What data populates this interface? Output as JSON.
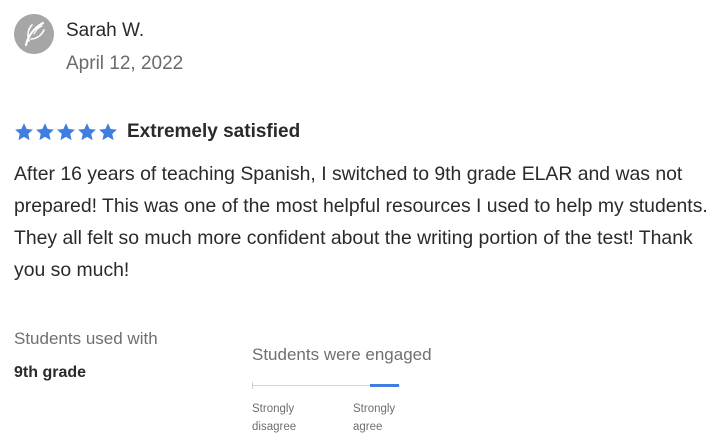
{
  "reviewer": {
    "name": "Sarah W.",
    "date": "April 12, 2022",
    "avatar_icon": "leaf-avatar-icon"
  },
  "rating": {
    "stars": 5,
    "max_stars": 5,
    "label": "Extremely satisfied",
    "star_color": "#3f7ee0"
  },
  "review": {
    "text": "After 16 years of teaching Spanish, I switched to 9th grade ELAR and was not prepared! This was one of the most helpful resources I used to help my students. They all felt so much more confident about the writing portion of the test! Thank you so much!"
  },
  "used_with": {
    "label": "Students used with",
    "value": "9th grade"
  },
  "engagement": {
    "label": "Students were engaged",
    "scale_min_line1": "Strongly",
    "scale_min_line2": "disagree",
    "scale_max_line1": "Strongly",
    "scale_max_line2": "agree",
    "level": 5,
    "max_level": 5,
    "accent": "#3f7ee0"
  }
}
